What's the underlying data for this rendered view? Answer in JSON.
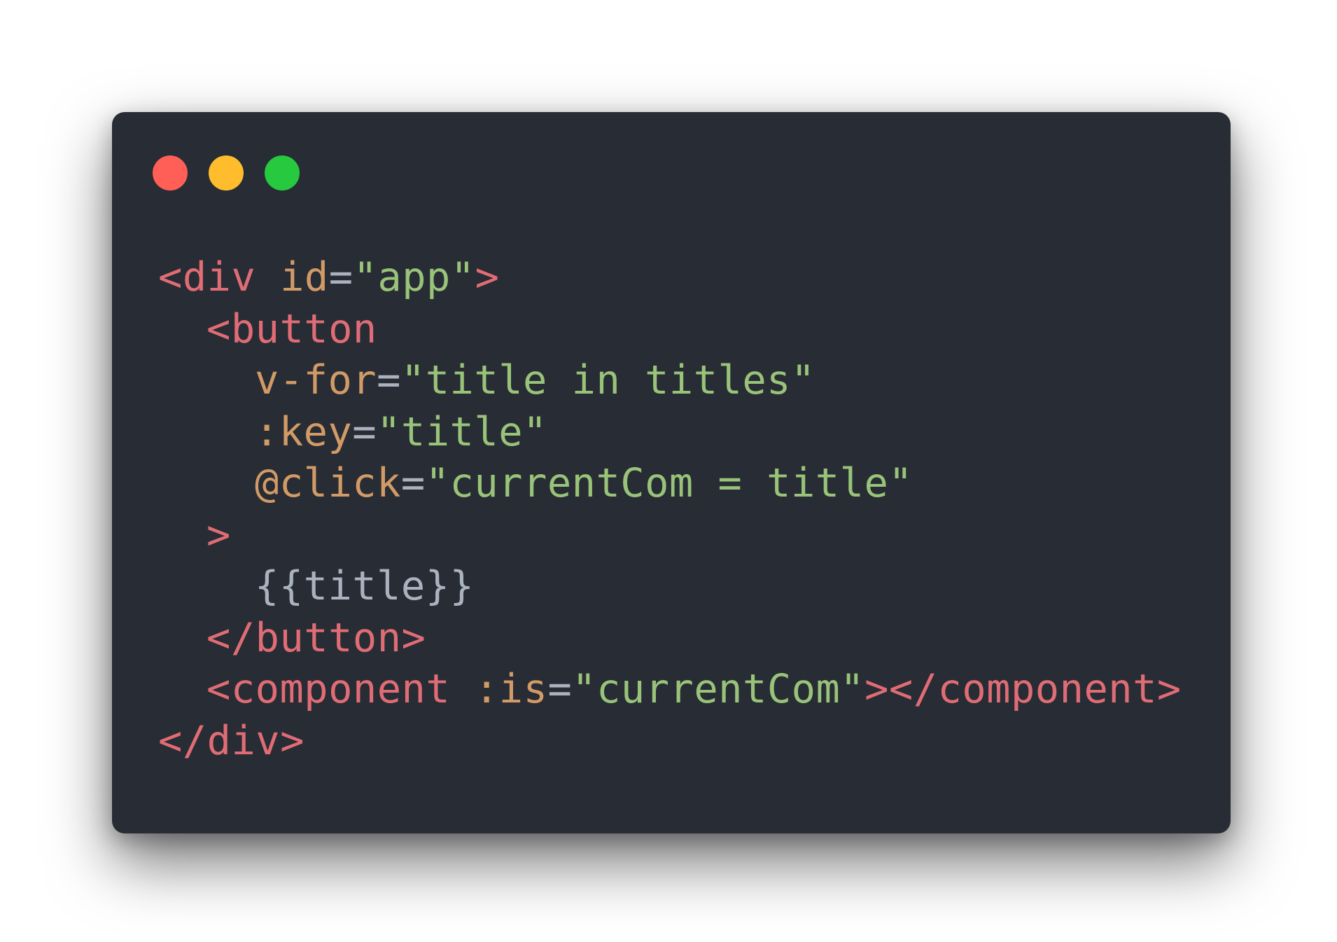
{
  "window": {
    "controls": [
      {
        "name": "close",
        "color": "#ff5f56"
      },
      {
        "name": "minimize",
        "color": "#ffbd2e"
      },
      {
        "name": "zoom",
        "color": "#27c93f"
      }
    ]
  },
  "colors": {
    "background": "#282c34",
    "tag": "#e06c75",
    "attribute": "#d19a66",
    "string": "#98c379",
    "text": "#abb2bf"
  },
  "code": {
    "l1": {
      "open": "<div",
      "attr": " id",
      "eq": "=",
      "val": "\"app\"",
      "close": ">"
    },
    "l2": {
      "open": "<button"
    },
    "l3": {
      "attr": "v-for",
      "eq": "=",
      "val": "\"title in titles\""
    },
    "l4": {
      "attr": ":key",
      "eq": "=",
      "val": "\"title\""
    },
    "l5": {
      "attr": "@click",
      "eq": "=",
      "val": "\"currentCom = title\""
    },
    "l6": {
      "close": ">"
    },
    "l7": {
      "text": "{{title}}"
    },
    "l8": {
      "tag": "</button>"
    },
    "l9": {
      "open": "<component",
      "attr": " :is",
      "eq": "=",
      "val": "\"currentCom\"",
      "tag": "></component>"
    },
    "l10": {
      "tag": "</div>"
    }
  }
}
